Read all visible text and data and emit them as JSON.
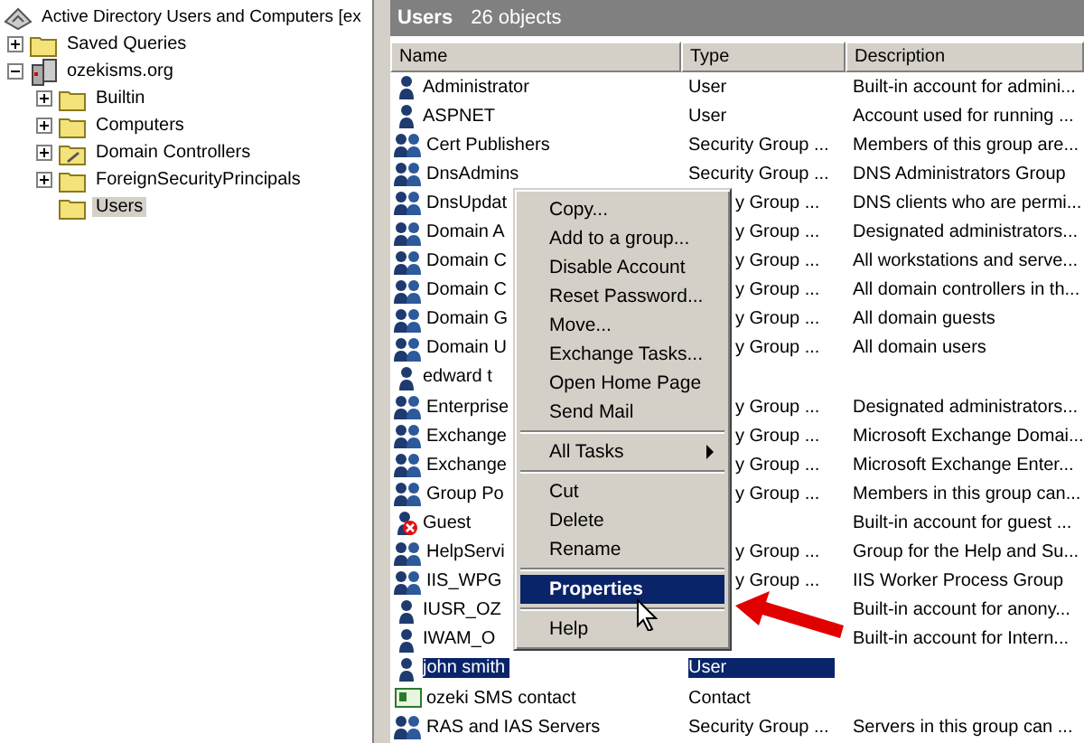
{
  "tree": {
    "title": "Active Directory Users and Computers [ex",
    "items": [
      {
        "label": "Saved Queries",
        "kind": "folder",
        "expanded": false,
        "selected": false
      },
      {
        "label": "ozekisms.org",
        "kind": "domain",
        "expanded": true,
        "selected": false,
        "children": [
          {
            "label": "Builtin",
            "kind": "folder",
            "expanded": false,
            "selected": false
          },
          {
            "label": "Computers",
            "kind": "folder",
            "expanded": false,
            "selected": false
          },
          {
            "label": "Domain Controllers",
            "kind": "ou",
            "expanded": false,
            "selected": false
          },
          {
            "label": "ForeignSecurityPrincipals",
            "kind": "folder",
            "expanded": false,
            "selected": false
          },
          {
            "label": "Users",
            "kind": "folder",
            "selected": true
          }
        ]
      }
    ]
  },
  "list": {
    "title": "Users",
    "count": "26 objects",
    "columns": [
      "Name",
      "Type",
      "Description"
    ],
    "rows": [
      {
        "kind": "user",
        "name": "Administrator",
        "type": "User",
        "description": "Built-in account for admini...",
        "selected": false
      },
      {
        "kind": "user",
        "name": "ASPNET",
        "type": "User",
        "description": "Account used for running ...",
        "selected": false
      },
      {
        "kind": "group",
        "name": "Cert Publishers",
        "type": "Security Group ...",
        "description": "Members of this group are...",
        "selected": false
      },
      {
        "kind": "group",
        "name": "DnsAdmins",
        "type": "Security Group ...",
        "description": "DNS Administrators Group",
        "selected": false
      },
      {
        "kind": "group",
        "name": "DnsUpdat",
        "type": "y Group ...",
        "under_menu": true,
        "description": "DNS clients who are permi...",
        "selected": false
      },
      {
        "kind": "group",
        "name": "Domain A",
        "type": "y Group ...",
        "under_menu": true,
        "description": "Designated administrators...",
        "selected": false
      },
      {
        "kind": "group",
        "name": "Domain C",
        "type": "y Group ...",
        "under_menu": true,
        "description": "All workstations and serve...",
        "selected": false
      },
      {
        "kind": "group",
        "name": "Domain C",
        "type": "y Group ...",
        "under_menu": true,
        "description": "All domain controllers in th...",
        "selected": false
      },
      {
        "kind": "group",
        "name": "Domain G",
        "type": "y Group ...",
        "under_menu": true,
        "description": "All domain guests",
        "selected": false
      },
      {
        "kind": "group",
        "name": "Domain U",
        "type": "y Group ...",
        "under_menu": true,
        "description": "All domain users",
        "selected": false
      },
      {
        "kind": "user",
        "name": "edward t",
        "selected": false
      },
      {
        "kind": "group",
        "name": "Enterprise",
        "type": "y Group ...",
        "under_menu": true,
        "description": "Designated administrators...",
        "selected": false
      },
      {
        "kind": "group",
        "name": "Exchange",
        "type": "y Group ...",
        "under_menu": true,
        "description": "Microsoft Exchange Domai...",
        "selected": false
      },
      {
        "kind": "group",
        "name": "Exchange",
        "type": "y Group ...",
        "under_menu": true,
        "description": "Microsoft Exchange Enter...",
        "selected": false
      },
      {
        "kind": "group",
        "name": "Group Po",
        "type": "y Group ...",
        "under_menu": true,
        "description": "Members in this group can...",
        "selected": false
      },
      {
        "kind": "user_disabled",
        "name": "Guest",
        "description": "Built-in account for guest ...",
        "selected": false
      },
      {
        "kind": "group",
        "name": "HelpServi",
        "type": "y Group ...",
        "under_menu": true,
        "description": "Group for the Help and Su...",
        "selected": false
      },
      {
        "kind": "group",
        "name": "IIS_WPG",
        "type": "y Group ...",
        "under_menu": true,
        "description": "IIS Worker Process Group",
        "selected": false
      },
      {
        "kind": "user",
        "name": "IUSR_OZ",
        "description": "Built-in account for anony...",
        "selected": false
      },
      {
        "kind": "user",
        "name": "IWAM_O",
        "description": "Built-in account for Intern...",
        "selected": false
      },
      {
        "kind": "user",
        "name": "john smith",
        "type": "User",
        "selected": true
      },
      {
        "kind": "contact",
        "name": "ozeki SMS contact",
        "type": "Contact",
        "selected": false
      },
      {
        "kind": "group",
        "name": "RAS and IAS Servers",
        "type": "Security Group ...",
        "description": "Servers in this group can ...",
        "selected": false
      }
    ]
  },
  "context_menu": {
    "items": [
      {
        "kind": "item",
        "label": "Copy...",
        "selected": false
      },
      {
        "kind": "item",
        "label": "Add to a group...",
        "selected": false
      },
      {
        "kind": "item",
        "label": "Disable Account",
        "selected": false
      },
      {
        "kind": "item",
        "label": "Reset Password...",
        "selected": false
      },
      {
        "kind": "item",
        "label": "Move...",
        "selected": false
      },
      {
        "kind": "item",
        "label": "Exchange Tasks...",
        "selected": false
      },
      {
        "kind": "item",
        "label": "Open Home Page",
        "selected": false
      },
      {
        "kind": "item",
        "label": "Send Mail",
        "selected": false
      },
      {
        "kind": "separator"
      },
      {
        "kind": "submenu",
        "label": "All Tasks",
        "selected": false
      },
      {
        "kind": "separator"
      },
      {
        "kind": "item",
        "label": "Cut",
        "selected": false
      },
      {
        "kind": "item",
        "label": "Delete",
        "selected": false
      },
      {
        "kind": "item",
        "label": "Rename",
        "selected": false
      },
      {
        "kind": "separator"
      },
      {
        "kind": "item",
        "label": "Properties",
        "selected": true
      },
      {
        "kind": "separator"
      },
      {
        "kind": "item",
        "label": "Help",
        "selected": false
      }
    ]
  }
}
